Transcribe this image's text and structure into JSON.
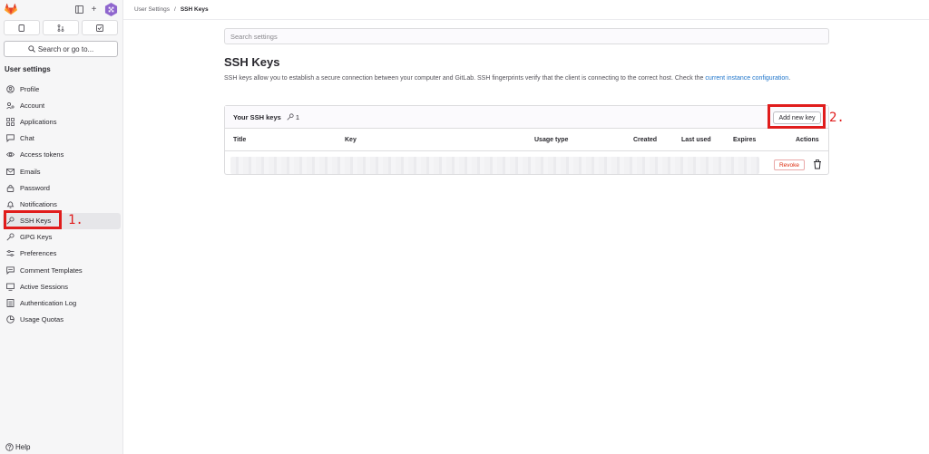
{
  "breadcrumb": {
    "parent": "User Settings",
    "separator": "/",
    "current": "SSH Keys"
  },
  "sidebar": {
    "search_label": "Search or go to...",
    "section_title": "User settings",
    "items": [
      {
        "label": "Profile",
        "icon": "profile-icon"
      },
      {
        "label": "Account",
        "icon": "account-icon"
      },
      {
        "label": "Applications",
        "icon": "applications-icon"
      },
      {
        "label": "Chat",
        "icon": "chat-icon"
      },
      {
        "label": "Access tokens",
        "icon": "token-icon"
      },
      {
        "label": "Emails",
        "icon": "mail-icon"
      },
      {
        "label": "Password",
        "icon": "lock-icon"
      },
      {
        "label": "Notifications",
        "icon": "bell-icon"
      },
      {
        "label": "SSH Keys",
        "icon": "key-icon",
        "active": true
      },
      {
        "label": "GPG Keys",
        "icon": "key-icon"
      },
      {
        "label": "Preferences",
        "icon": "preferences-icon"
      },
      {
        "label": "Comment Templates",
        "icon": "comment-icon"
      },
      {
        "label": "Active Sessions",
        "icon": "monitor-icon"
      },
      {
        "label": "Authentication Log",
        "icon": "log-icon"
      },
      {
        "label": "Usage Quotas",
        "icon": "quota-icon"
      }
    ],
    "help_label": "Help"
  },
  "main": {
    "search_placeholder": "Search settings",
    "title": "SSH Keys",
    "description": "SSH keys allow you to establish a secure connection between your computer and GitLab. SSH fingerprints verify that the client is connecting to the correct host. Check the",
    "description_link": "current instance configuration",
    "description_end": ".",
    "card": {
      "title": "Your SSH keys",
      "count": "1",
      "add_button": "Add new key",
      "columns": [
        "Title",
        "Key",
        "Usage type",
        "Created",
        "Last used",
        "Expires",
        "Actions"
      ],
      "row": {
        "revoke_label": "Revoke"
      }
    }
  },
  "annotations": {
    "label_1": "1.",
    "label_2": "2."
  },
  "colors": {
    "accent": "#1f75cb",
    "annotation": "#e01c1c",
    "danger": "#dd2b0e"
  }
}
